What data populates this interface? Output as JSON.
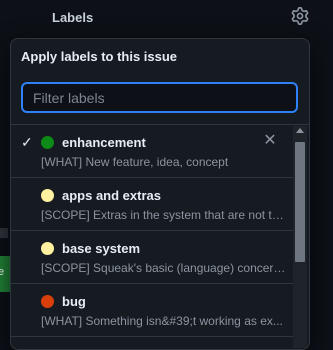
{
  "page": {
    "labels_header": "Labels"
  },
  "popover": {
    "title": "Apply labels to this issue",
    "filter": {
      "placeholder": "Filter labels",
      "value": ""
    },
    "items": [
      {
        "name": "enhancement",
        "description": "[WHAT] New feature, idea, concept",
        "color": "#0e8a16",
        "selected": true,
        "check": "✓",
        "remove": "✕"
      },
      {
        "name": "apps and extras",
        "description": "[SCOPE] Extras in the system that are not to...",
        "color": "#fef2a0",
        "selected": false
      },
      {
        "name": "base system",
        "description": "[SCOPE] Squeak's basic (language) concerns...",
        "color": "#fef2a0",
        "selected": false
      },
      {
        "name": "bug",
        "description": "[WHAT] Something isn&#39;t working as ex...",
        "color": "#d93f0b",
        "selected": false
      }
    ]
  },
  "colors": {
    "accent": "#2f81f7",
    "bg": "#0d1117",
    "surface": "#161b22",
    "border": "#30363d"
  },
  "icons": {
    "gear": "gear-icon",
    "check": "check-icon",
    "close": "close-icon"
  },
  "scrollbar": {
    "position_fraction": 0.0
  },
  "side": {
    "green_label": "e"
  }
}
